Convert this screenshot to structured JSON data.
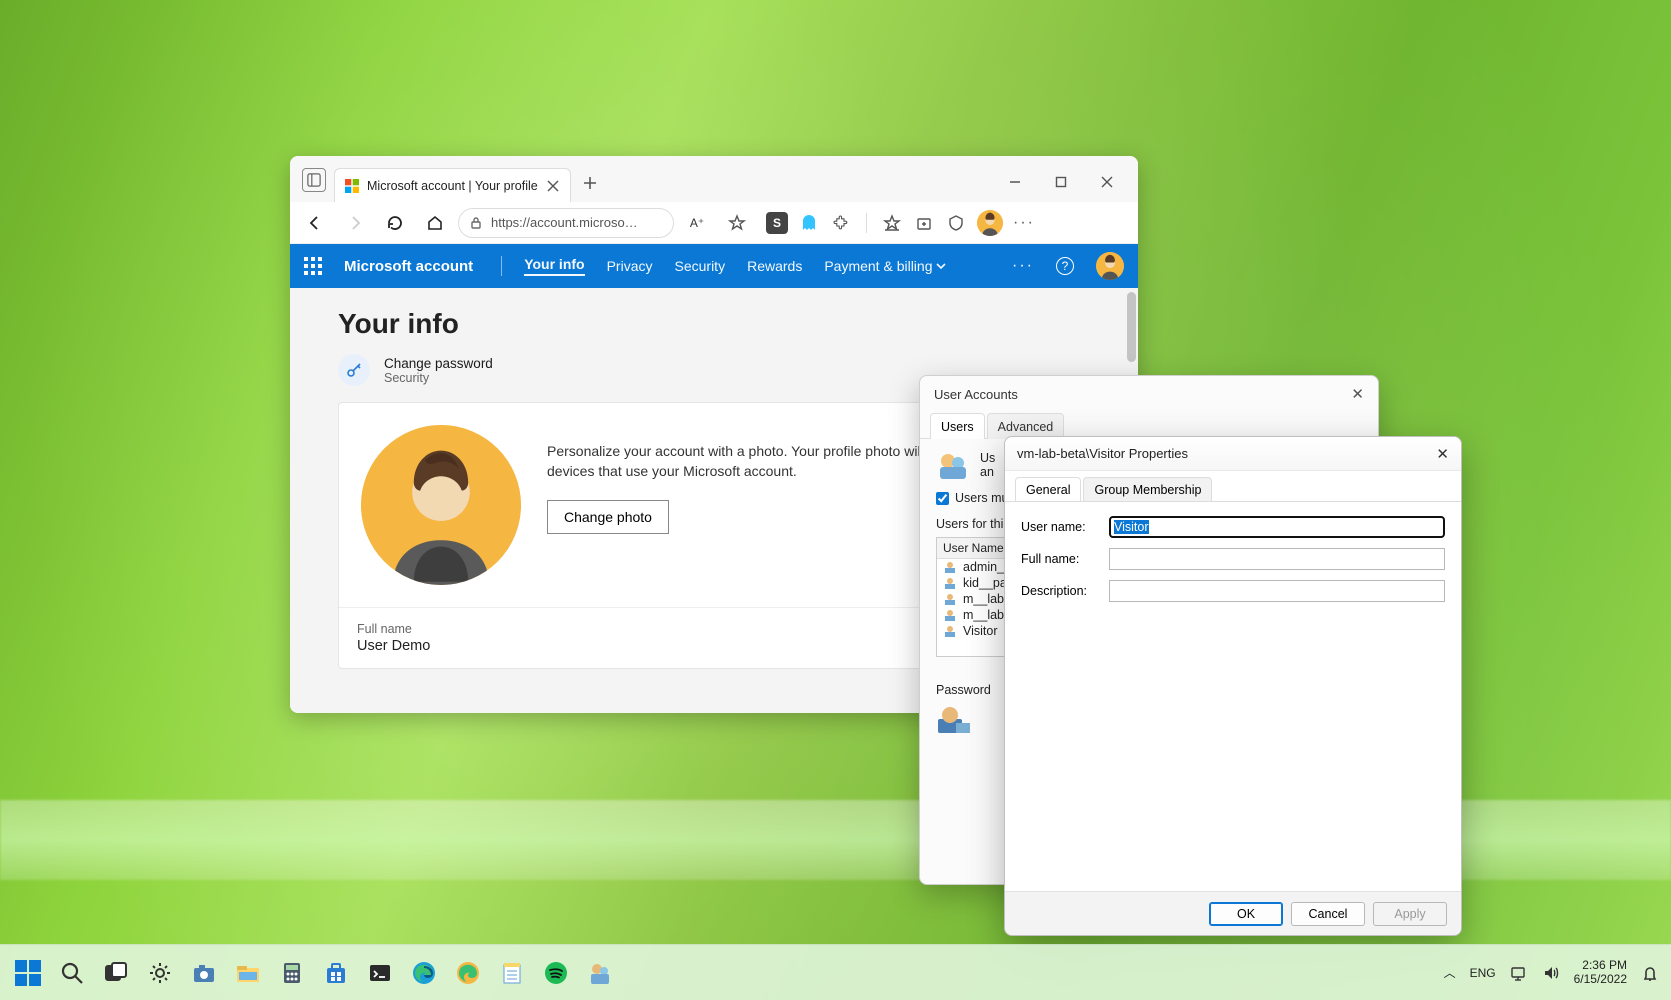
{
  "browser": {
    "tab_title": "Microsoft account | Your profile",
    "url_display": "https://account.microso…",
    "read_aloud_label": "A⁺",
    "header": {
      "brand": "Microsoft account",
      "nav": [
        "Your info",
        "Privacy",
        "Security",
        "Rewards",
        "Payment & billing"
      ],
      "active_index": 0
    },
    "page": {
      "heading": "Your info",
      "change_password": "Change password",
      "change_password_sub": "Security",
      "personalize_text": "Personalize your account with a photo. Your profile photo will appear on apps and devices that use your Microsoft account.",
      "change_photo_btn": "Change photo",
      "full_name_label": "Full name",
      "full_name_value": "User Demo"
    }
  },
  "user_accounts": {
    "title": "User Accounts",
    "tabs": [
      "Users",
      "Advanced"
    ],
    "intro_partial": "Us",
    "intro_partial2": "an",
    "checkbox_label": "Users mu",
    "list_label": "Users for thi",
    "list_header": "User Name",
    "users": [
      "admin_",
      "kid__pa",
      "m__lab",
      "m__lab.",
      "Visitor"
    ],
    "password_label": "Password"
  },
  "properties": {
    "title": "vm-lab-beta\\Visitor Properties",
    "tabs": [
      "General",
      "Group Membership"
    ],
    "username_label": "User name:",
    "username_value": "Visitor",
    "fullname_label": "Full name:",
    "fullname_value": "",
    "description_label": "Description:",
    "description_value": "",
    "buttons": {
      "ok": "OK",
      "cancel": "Cancel",
      "apply": "Apply"
    }
  },
  "taskbar": {
    "lang": "ENG",
    "time": "2:36 PM",
    "date": "6/15/2022"
  }
}
